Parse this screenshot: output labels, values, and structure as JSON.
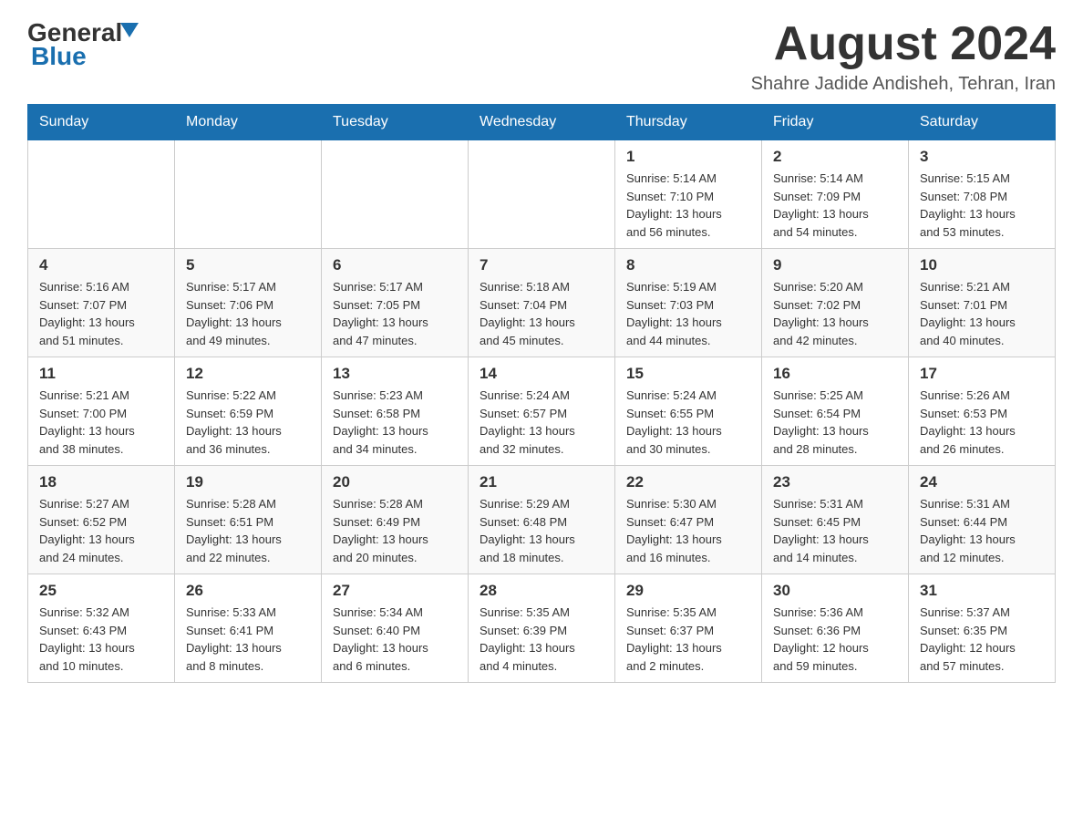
{
  "header": {
    "logo_general": "General",
    "logo_blue": "Blue",
    "month_title": "August 2024",
    "subtitle": "Shahre Jadide Andisheh, Tehran, Iran"
  },
  "weekdays": [
    "Sunday",
    "Monday",
    "Tuesday",
    "Wednesday",
    "Thursday",
    "Friday",
    "Saturday"
  ],
  "weeks": [
    [
      {
        "day": "",
        "info": ""
      },
      {
        "day": "",
        "info": ""
      },
      {
        "day": "",
        "info": ""
      },
      {
        "day": "",
        "info": ""
      },
      {
        "day": "1",
        "info": "Sunrise: 5:14 AM\nSunset: 7:10 PM\nDaylight: 13 hours\nand 56 minutes."
      },
      {
        "day": "2",
        "info": "Sunrise: 5:14 AM\nSunset: 7:09 PM\nDaylight: 13 hours\nand 54 minutes."
      },
      {
        "day": "3",
        "info": "Sunrise: 5:15 AM\nSunset: 7:08 PM\nDaylight: 13 hours\nand 53 minutes."
      }
    ],
    [
      {
        "day": "4",
        "info": "Sunrise: 5:16 AM\nSunset: 7:07 PM\nDaylight: 13 hours\nand 51 minutes."
      },
      {
        "day": "5",
        "info": "Sunrise: 5:17 AM\nSunset: 7:06 PM\nDaylight: 13 hours\nand 49 minutes."
      },
      {
        "day": "6",
        "info": "Sunrise: 5:17 AM\nSunset: 7:05 PM\nDaylight: 13 hours\nand 47 minutes."
      },
      {
        "day": "7",
        "info": "Sunrise: 5:18 AM\nSunset: 7:04 PM\nDaylight: 13 hours\nand 45 minutes."
      },
      {
        "day": "8",
        "info": "Sunrise: 5:19 AM\nSunset: 7:03 PM\nDaylight: 13 hours\nand 44 minutes."
      },
      {
        "day": "9",
        "info": "Sunrise: 5:20 AM\nSunset: 7:02 PM\nDaylight: 13 hours\nand 42 minutes."
      },
      {
        "day": "10",
        "info": "Sunrise: 5:21 AM\nSunset: 7:01 PM\nDaylight: 13 hours\nand 40 minutes."
      }
    ],
    [
      {
        "day": "11",
        "info": "Sunrise: 5:21 AM\nSunset: 7:00 PM\nDaylight: 13 hours\nand 38 minutes."
      },
      {
        "day": "12",
        "info": "Sunrise: 5:22 AM\nSunset: 6:59 PM\nDaylight: 13 hours\nand 36 minutes."
      },
      {
        "day": "13",
        "info": "Sunrise: 5:23 AM\nSunset: 6:58 PM\nDaylight: 13 hours\nand 34 minutes."
      },
      {
        "day": "14",
        "info": "Sunrise: 5:24 AM\nSunset: 6:57 PM\nDaylight: 13 hours\nand 32 minutes."
      },
      {
        "day": "15",
        "info": "Sunrise: 5:24 AM\nSunset: 6:55 PM\nDaylight: 13 hours\nand 30 minutes."
      },
      {
        "day": "16",
        "info": "Sunrise: 5:25 AM\nSunset: 6:54 PM\nDaylight: 13 hours\nand 28 minutes."
      },
      {
        "day": "17",
        "info": "Sunrise: 5:26 AM\nSunset: 6:53 PM\nDaylight: 13 hours\nand 26 minutes."
      }
    ],
    [
      {
        "day": "18",
        "info": "Sunrise: 5:27 AM\nSunset: 6:52 PM\nDaylight: 13 hours\nand 24 minutes."
      },
      {
        "day": "19",
        "info": "Sunrise: 5:28 AM\nSunset: 6:51 PM\nDaylight: 13 hours\nand 22 minutes."
      },
      {
        "day": "20",
        "info": "Sunrise: 5:28 AM\nSunset: 6:49 PM\nDaylight: 13 hours\nand 20 minutes."
      },
      {
        "day": "21",
        "info": "Sunrise: 5:29 AM\nSunset: 6:48 PM\nDaylight: 13 hours\nand 18 minutes."
      },
      {
        "day": "22",
        "info": "Sunrise: 5:30 AM\nSunset: 6:47 PM\nDaylight: 13 hours\nand 16 minutes."
      },
      {
        "day": "23",
        "info": "Sunrise: 5:31 AM\nSunset: 6:45 PM\nDaylight: 13 hours\nand 14 minutes."
      },
      {
        "day": "24",
        "info": "Sunrise: 5:31 AM\nSunset: 6:44 PM\nDaylight: 13 hours\nand 12 minutes."
      }
    ],
    [
      {
        "day": "25",
        "info": "Sunrise: 5:32 AM\nSunset: 6:43 PM\nDaylight: 13 hours\nand 10 minutes."
      },
      {
        "day": "26",
        "info": "Sunrise: 5:33 AM\nSunset: 6:41 PM\nDaylight: 13 hours\nand 8 minutes."
      },
      {
        "day": "27",
        "info": "Sunrise: 5:34 AM\nSunset: 6:40 PM\nDaylight: 13 hours\nand 6 minutes."
      },
      {
        "day": "28",
        "info": "Sunrise: 5:35 AM\nSunset: 6:39 PM\nDaylight: 13 hours\nand 4 minutes."
      },
      {
        "day": "29",
        "info": "Sunrise: 5:35 AM\nSunset: 6:37 PM\nDaylight: 13 hours\nand 2 minutes."
      },
      {
        "day": "30",
        "info": "Sunrise: 5:36 AM\nSunset: 6:36 PM\nDaylight: 12 hours\nand 59 minutes."
      },
      {
        "day": "31",
        "info": "Sunrise: 5:37 AM\nSunset: 6:35 PM\nDaylight: 12 hours\nand 57 minutes."
      }
    ]
  ]
}
